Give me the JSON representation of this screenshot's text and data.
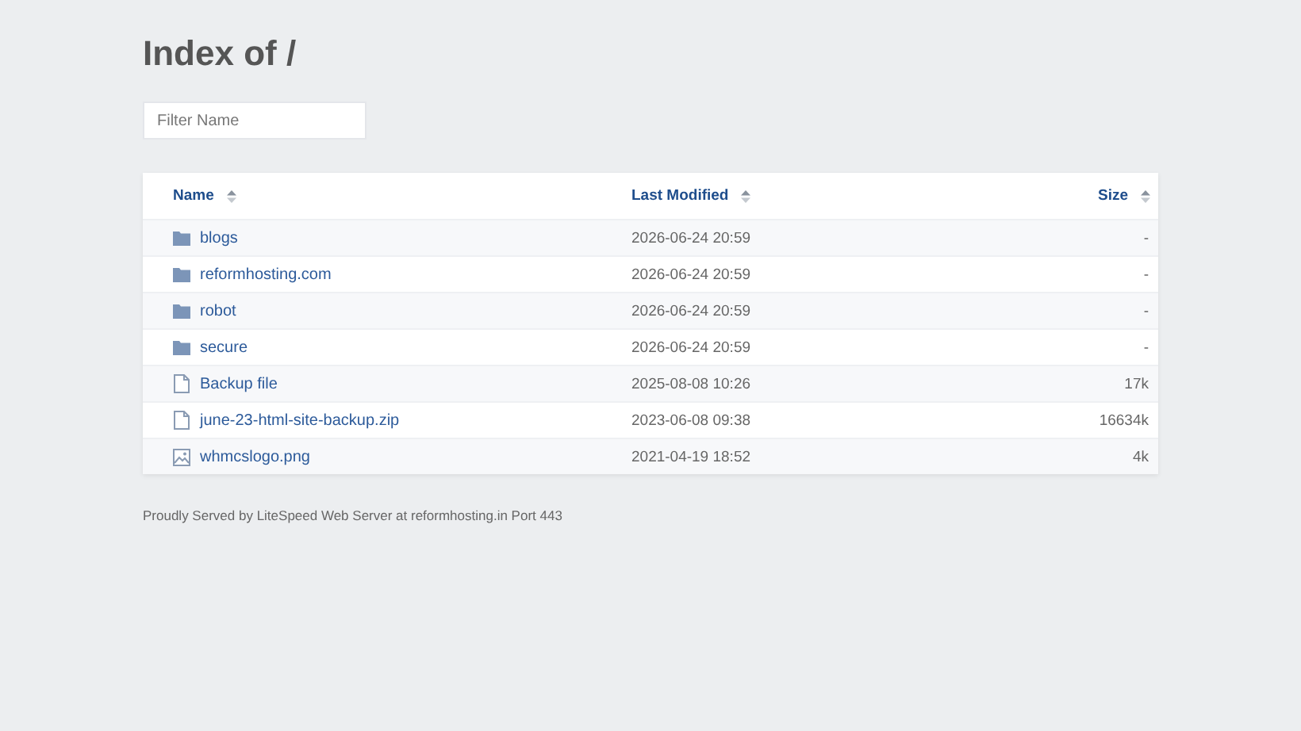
{
  "title": "Index of /",
  "filter": {
    "placeholder": "Filter Name"
  },
  "columns": [
    "Name",
    "Last Modified",
    "Size"
  ],
  "rows": [
    {
      "kind": "folder",
      "name": "blogs",
      "modified": "2026-06-24 20:59",
      "size": "-"
    },
    {
      "kind": "folder",
      "name": "reformhosting.com",
      "modified": "2026-06-24 20:59",
      "size": "-"
    },
    {
      "kind": "folder",
      "name": "robot",
      "modified": "2026-06-24 20:59",
      "size": "-"
    },
    {
      "kind": "folder",
      "name": "secure",
      "modified": "2026-06-24 20:59",
      "size": "-"
    },
    {
      "kind": "file",
      "name": "Backup file",
      "modified": "2025-08-08 10:26",
      "size": "17k"
    },
    {
      "kind": "file",
      "name": "june-23-html-site-backup.zip",
      "modified": "2023-06-08 09:38",
      "size": "16634k"
    },
    {
      "kind": "image",
      "name": "whmcslogo.png",
      "modified": "2021-04-19 18:52",
      "size": "4k"
    }
  ],
  "footer": "Proudly Served by LiteSpeed Web Server at reformhosting.in Port 443"
}
